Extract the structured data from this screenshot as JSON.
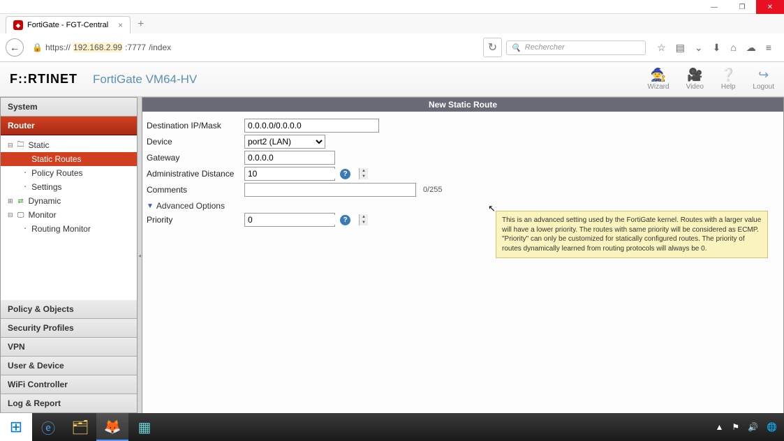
{
  "window": {
    "minimize": "—",
    "maximize": "❐",
    "close": "✕"
  },
  "browser": {
    "tab_title": "FortiGate - FGT-Central",
    "url_pre": "https://",
    "url_host": "192.168.2.99",
    "url_port": ":7777",
    "url_path": "/index",
    "search_placeholder": "Rechercher"
  },
  "header": {
    "logo": "F::RTINET",
    "product": "FortiGate VM64-HV",
    "actions": {
      "wizard": "Wizard",
      "video": "Video",
      "help": "Help",
      "logout": "Logout"
    }
  },
  "sidebar": {
    "sections": {
      "system": "System",
      "router": "Router",
      "policy": "Policy & Objects",
      "security": "Security Profiles",
      "vpn": "VPN",
      "user": "User & Device",
      "wifi": "WiFi Controller",
      "log": "Log & Report"
    },
    "tree": {
      "static": "Static",
      "static_routes": "Static Routes",
      "policy_routes": "Policy Routes",
      "settings": "Settings",
      "dynamic": "Dynamic",
      "monitor": "Monitor",
      "routing_monitor": "Routing Monitor"
    }
  },
  "panel": {
    "title": "New Static Route",
    "labels": {
      "dest": "Destination IP/Mask",
      "device": "Device",
      "gateway": "Gateway",
      "admin": "Administrative Distance",
      "comments": "Comments",
      "advanced": "Advanced Options",
      "priority": "Priority"
    },
    "values": {
      "dest": "0.0.0.0/0.0.0.0",
      "device": "port2 (LAN)",
      "gateway": "0.0.0.0",
      "admin": "10",
      "comments": "",
      "char_count": "0/255",
      "priority": "0"
    },
    "tooltip": "This is an advanced setting used by the FortiGate kernel. Routes with a larger value will have a lower priority. The routes with same priority will be considered as ECMP. \"Priority\" can only be customized for statically configured routes. The priority of routes dynamically learned from routing protocols will always be 0."
  },
  "taskbar": {
    "tray_up": "▲"
  }
}
